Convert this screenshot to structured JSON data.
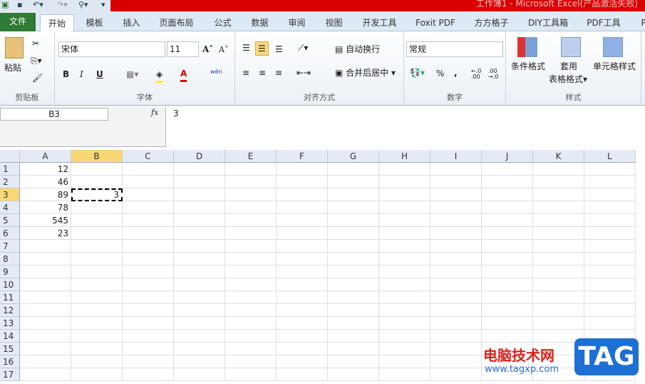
{
  "title": "工作簿1 - Microsoft Excel(产品激活失败)",
  "tabs": [
    "文件",
    "开始",
    "模板",
    "插入",
    "页面布局",
    "公式",
    "数据",
    "审阅",
    "视图",
    "开发工具",
    "Foxit PDF",
    "方方格子",
    "DIY工具箱",
    "PDF工具",
    "P"
  ],
  "active_tab": "开始",
  "ribbon": {
    "clipboard": {
      "label": "剪贴板",
      "paste": "粘贴"
    },
    "font": {
      "label": "字体",
      "name": "宋体",
      "size": "11",
      "bold": "B",
      "italic": "I",
      "underline": "U",
      "color": "A",
      "phonetic": "wén"
    },
    "align": {
      "label": "对齐方式",
      "wrap": "自动换行",
      "merge": "合并后居中"
    },
    "number": {
      "label": "数字",
      "format": "常规",
      "percent": "%",
      "comma": ",",
      "inc": "←.0 .00",
      "dec": ".00 →.0"
    },
    "styles": {
      "label": "样式",
      "cond": "条件格式",
      "table1": "套用",
      "table2": "表格格式",
      "cell": "单元格样式"
    }
  },
  "formula_bar": {
    "name_box": "B3",
    "fx": "fx",
    "value": "3"
  },
  "columns": [
    "A",
    "B",
    "C",
    "D",
    "E",
    "F",
    "G",
    "H",
    "I",
    "J",
    "K",
    "L"
  ],
  "rows": [
    "1",
    "2",
    "3",
    "4",
    "5",
    "6",
    "7",
    "8",
    "9",
    "10",
    "11",
    "12",
    "13",
    "14",
    "15",
    "16",
    "17"
  ],
  "cells": {
    "A1": "12",
    "A2": "46",
    "A3": "89",
    "A4": "78",
    "A5": "545",
    "A6": "23",
    "B3": "3"
  },
  "selected": "B3",
  "watermark": {
    "site_name": "电脑技术网",
    "url": "www.tagxp.com",
    "logo": "TAG"
  }
}
